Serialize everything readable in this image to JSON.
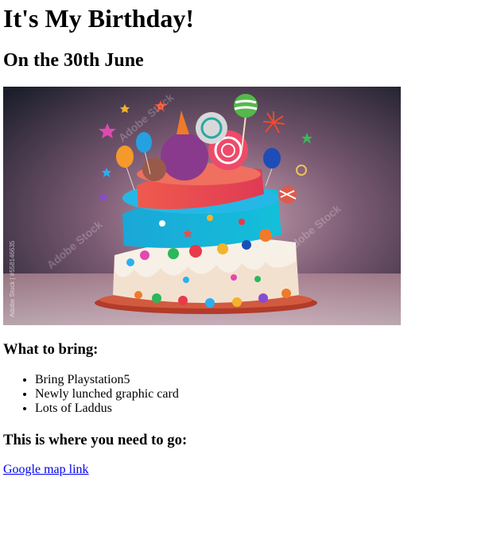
{
  "title": "It's My Birthday!",
  "subtitle": "On the 30th June",
  "image": {
    "watermark": "Adobe Stock",
    "side_credit": "Adobe Stock | #558146635"
  },
  "bring": {
    "heading": "What to bring:",
    "items": [
      "Bring Playstation5",
      "Newly lunched graphic card",
      "Lots of Laddus"
    ]
  },
  "location": {
    "heading": "This is where you need to go:",
    "link_text": "Google map link"
  },
  "colors": {
    "link": "#0000ee"
  }
}
